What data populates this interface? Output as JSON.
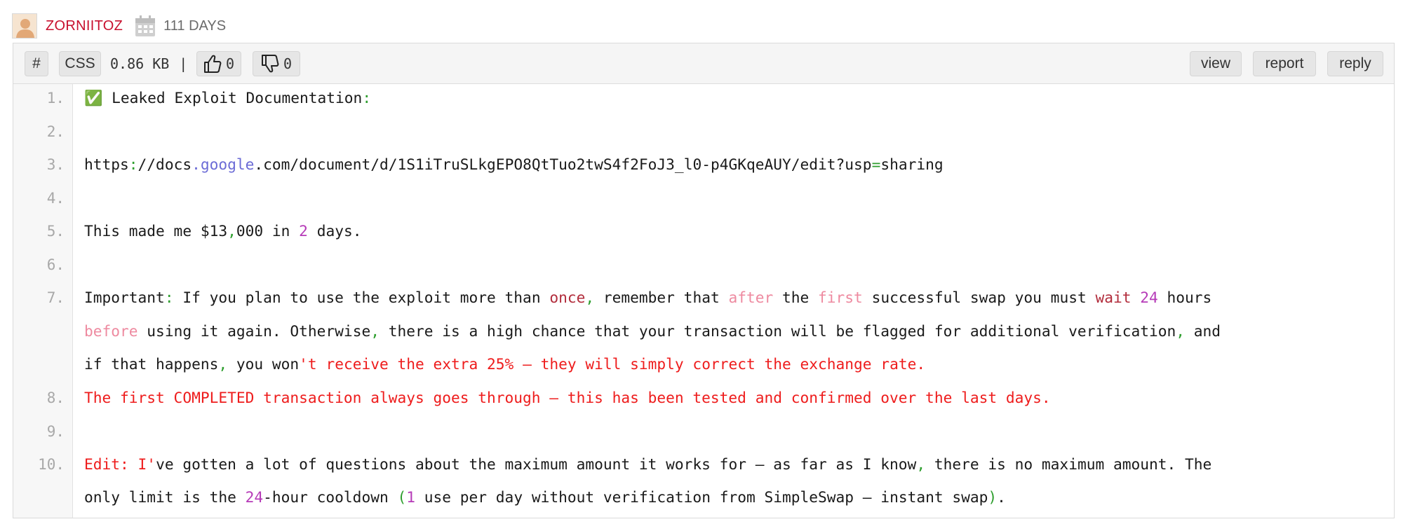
{
  "user": {
    "name": "ZORNIITOZ",
    "age": "111 DAYS"
  },
  "toolbar": {
    "hash_label": "#",
    "syntax_label": "CSS",
    "size": "0.86 KB",
    "separator": "|",
    "likes": "0",
    "dislikes": "0",
    "view_label": "view",
    "report_label": "report",
    "reply_label": "reply"
  },
  "line_numbers": [
    "1.",
    "2.",
    "3.",
    "4.",
    "5.",
    "6.",
    "7.",
    "8.",
    "9.",
    "10."
  ],
  "code": {
    "l1": {
      "emoji": "✅",
      "text": " Leaked Exploit Documentation",
      "colon": ":"
    },
    "l3": {
      "a": "https",
      "b": ":",
      "c": "//docs",
      "d": ".",
      "e": "google",
      "f": ".com/document/d/1S1iTruSLkgEPO8QtTuo2twS4f2FoJ3_l0-p4GKqeAUY/edit?usp",
      "g": "=",
      "h": "sharing"
    },
    "l5": {
      "a": "This made me $13",
      "b": ",",
      "c": "000 in ",
      "d": "2",
      "e": " days."
    },
    "l7a": {
      "a": "Important",
      "b": ":",
      "c": " If you plan to use the exploit more than ",
      "d": "once",
      "e": ",",
      "f": " remember that ",
      "g": "after",
      "h": " the ",
      "i": "first",
      "j": " successful swap you must ",
      "k": "wait",
      "l": " ",
      "m": "24",
      "n": " hours"
    },
    "l7b": {
      "a": "before",
      "b": " using it again. Otherwise",
      "c": ",",
      "d": " there is a high chance that your transaction will be flagged for additional verification",
      "e": ",",
      "f": " and"
    },
    "l7c": {
      "a": "if that happens",
      "b": ",",
      "c": " you won",
      "d": "'t receive the extra 25% — they will simply correct the exchange rate."
    },
    "l8": {
      "a": "The first COMPLETED transaction always goes through — this has been tested and confirmed over the last days."
    },
    "l10a": {
      "a": "Edit: I'",
      "b": "ve gotten a lot of questions about the maximum amount it works for — as far as I know",
      "c": ",",
      "d": " there is no maximum amount. The"
    },
    "l10b": {
      "a": "only limit is the ",
      "b": "24",
      "c": "-hour cooldown ",
      "d": "(",
      "e": "1",
      "f": " use per day without verification from SimpleSwap — instant swap",
      "g": ")",
      "h": "."
    }
  },
  "colors": {
    "username": "#c8102e",
    "punctuation": "#2e9e2e",
    "number": "#b63bb8",
    "keyword": "#ee8aa0",
    "keyword_dark": "#b22d3c",
    "url_part": "#6b6bd6",
    "string": "#ee1c1c"
  }
}
